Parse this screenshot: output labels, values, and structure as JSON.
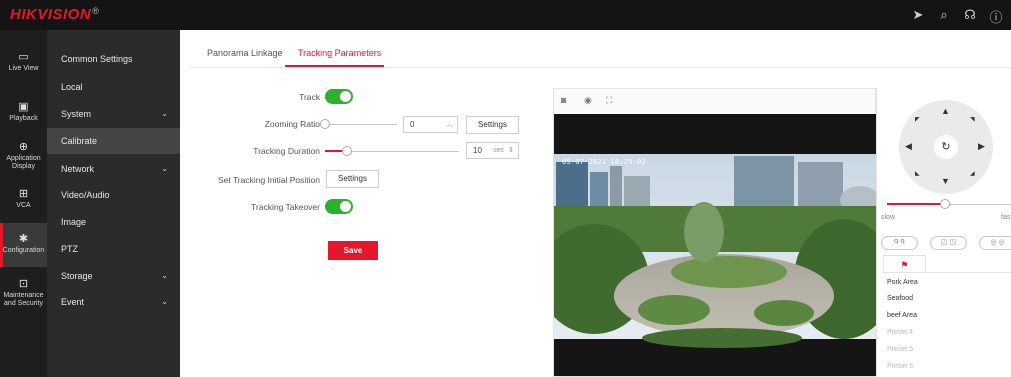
{
  "brand": {
    "name": "HIKVISION",
    "mark": "®",
    "color": "#e4172b"
  },
  "top_icons": [
    "send-icon",
    "search-icon",
    "help-icon",
    "info-icon"
  ],
  "rail": [
    {
      "label": "Live View",
      "icon": "monitor-icon"
    },
    {
      "label": "Playback",
      "icon": "playback-icon"
    },
    {
      "label": "Application Display",
      "icon": "application-icon"
    },
    {
      "label": "VCA",
      "icon": "vca-icon"
    },
    {
      "label": "Configuration",
      "icon": "gear-icon",
      "active": true
    },
    {
      "label": "Maintenance and Security",
      "icon": "maintenance-icon"
    }
  ],
  "menu": [
    {
      "label": "Common Settings",
      "expandable": false
    },
    {
      "label": "Local",
      "expandable": false
    },
    {
      "label": "System",
      "expandable": true
    },
    {
      "label": "Calibrate",
      "expandable": false,
      "active": true
    },
    {
      "label": "Network",
      "expandable": true
    },
    {
      "label": "Video/Audio",
      "expandable": false
    },
    {
      "label": "Image",
      "expandable": false
    },
    {
      "label": "PTZ",
      "expandable": false
    },
    {
      "label": "Storage",
      "expandable": true
    },
    {
      "label": "Event",
      "expandable": true
    }
  ],
  "tabs": [
    {
      "label": "Panorama Linkage"
    },
    {
      "label": "Tracking Parameters",
      "active": true
    }
  ],
  "form": {
    "track_label": "Track",
    "track_on": true,
    "zoom_label": "Zooming Ratio",
    "zoom_value": "0",
    "zoom_slider_fraction": 0,
    "zoom_settings_label": "Settings",
    "duration_label": "Tracking Duration",
    "duration_value": "10",
    "duration_unit": "sec",
    "duration_slider_fraction": 0.15,
    "initial_label": "Set Tracking Initial Position",
    "initial_settings_label": "Settings",
    "takeover_label": "Tracking Takeover",
    "takeover_on": true,
    "save_label": "Save"
  },
  "preview": {
    "toolbar_icons": [
      "camera-icon",
      "record-icon",
      "fullscreen-icon"
    ],
    "osd_text": "05-07-2021 16:29:02"
  },
  "ptz": {
    "speed_slow": "slow",
    "speed_fast": "fas",
    "speed_fraction": 0.45,
    "presets": [
      "Pork Area",
      "Seafood",
      "beef Area",
      "Preset 4",
      "Preset 5",
      "Preset 6"
    ]
  },
  "colors": {
    "accent": "#e4172b",
    "toggle_on": "#2bb12b"
  }
}
